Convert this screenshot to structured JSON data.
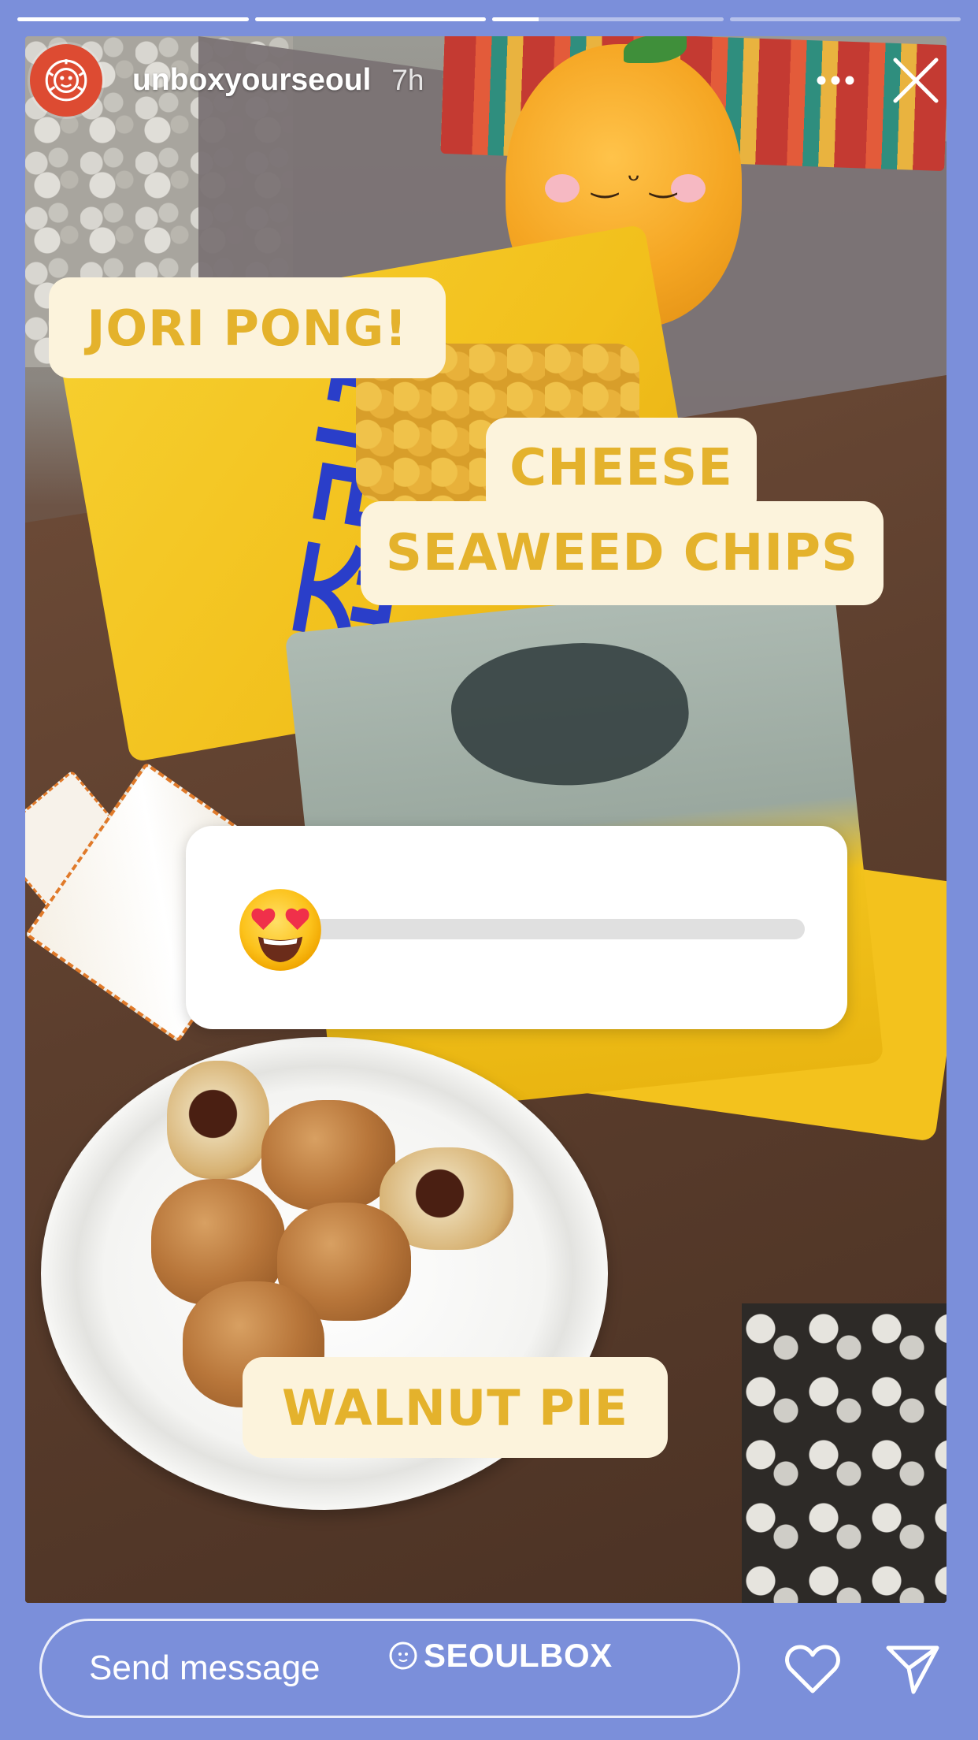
{
  "story": {
    "progress_segments": [
      {
        "fill_fraction": 1.0
      },
      {
        "fill_fraction": 1.0
      },
      {
        "fill_fraction": 0.2
      },
      {
        "fill_fraction": 0.0
      }
    ]
  },
  "header": {
    "username": "unboxyourseoul",
    "time": "7h",
    "avatar_icon": "lion-logo-icon",
    "more_icon": "more-icon",
    "close_icon": "close-icon"
  },
  "stickers": {
    "jori": "JORI PONG!",
    "cheese_line1": "CHEESE",
    "cheese_line2": "SEAWEED CHIPS",
    "walnut": "WALNUT PIE"
  },
  "emoji_slider": {
    "emoji": "heart-eyes-emoji",
    "value_fraction": 0.0
  },
  "footer": {
    "send_placeholder": "Send message",
    "watermark": "SEOULBOX",
    "like_icon": "heart-icon",
    "share_icon": "send-icon"
  },
  "colors": {
    "background": "#7b8fda",
    "sticker_bg": "#fcf3dc",
    "sticker_text": "#e4b22c",
    "avatar": "#dd4b32"
  }
}
